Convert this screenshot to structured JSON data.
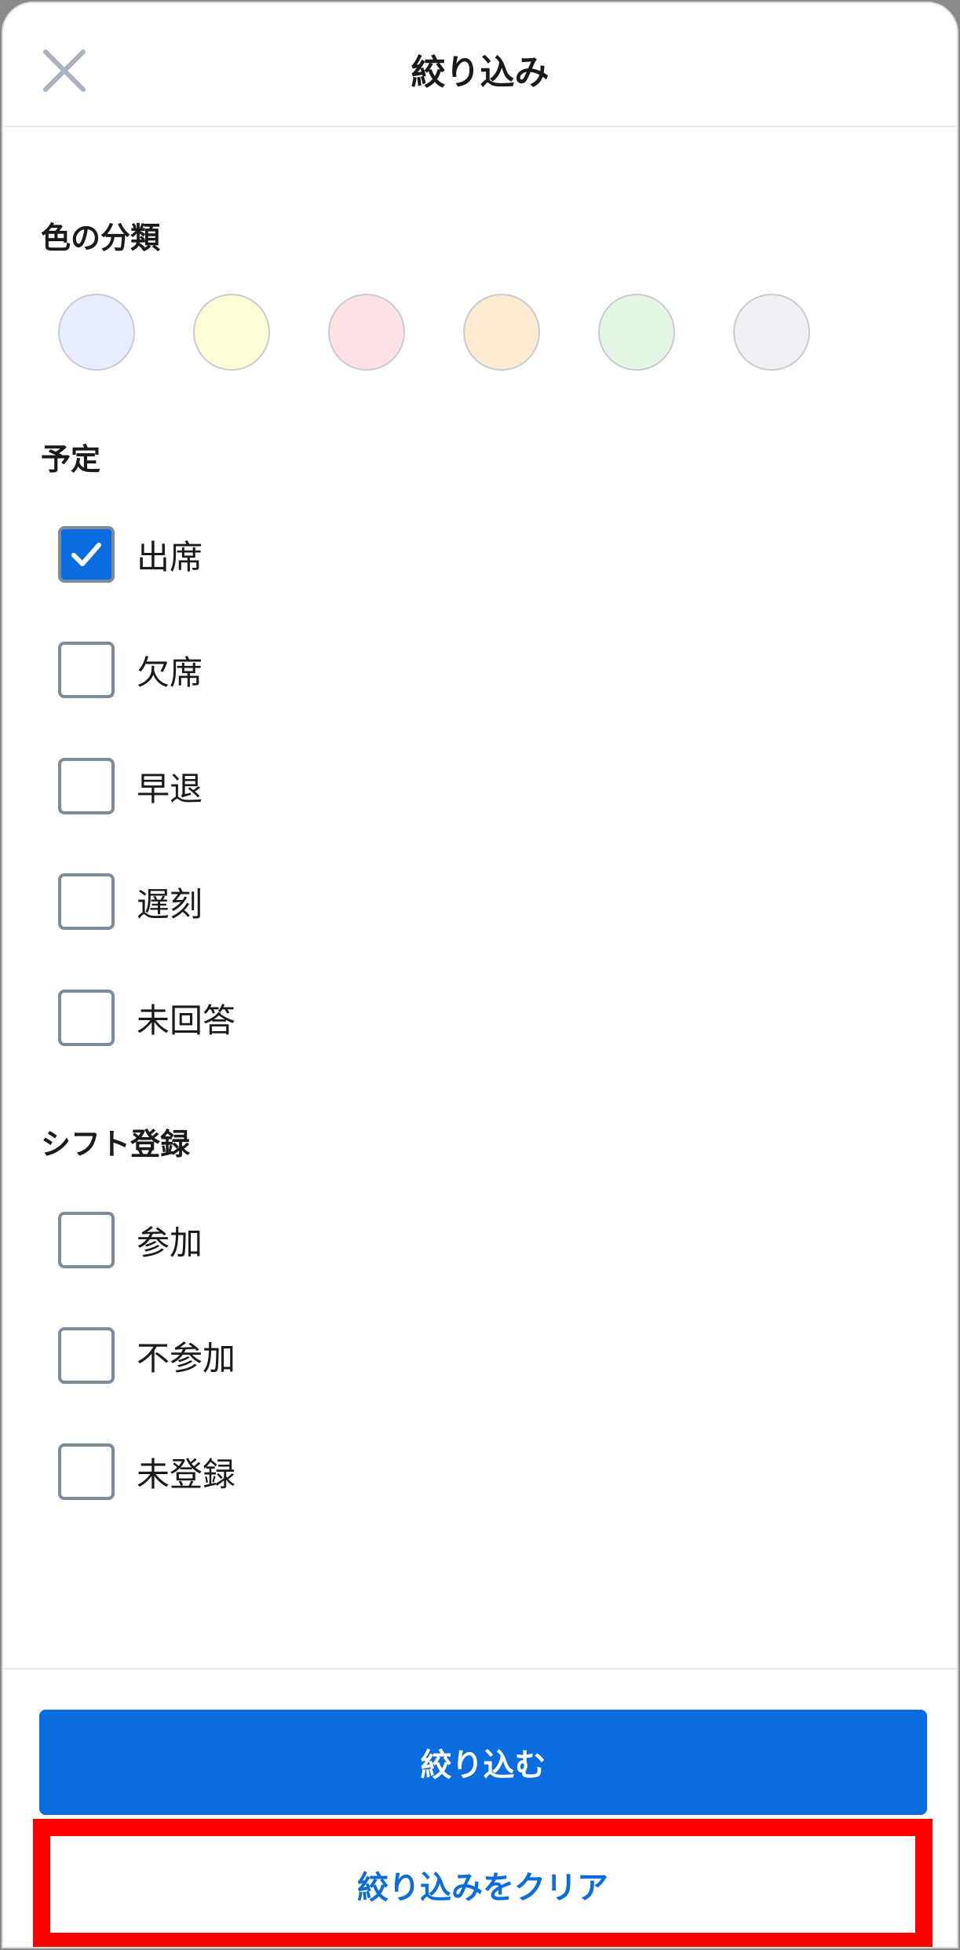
{
  "header": {
    "title": "絞り込み",
    "close_icon": "close-icon"
  },
  "colors_section": {
    "title": "色の分類",
    "swatches": [
      "#e8eeff",
      "#ffffd6",
      "#ffe2e5",
      "#ffead2",
      "#e4f7e4",
      "#f0f1f5"
    ]
  },
  "schedule_section": {
    "title": "予定",
    "items": [
      {
        "label": "出席",
        "checked": true
      },
      {
        "label": "欠席",
        "checked": false
      },
      {
        "label": "早退",
        "checked": false
      },
      {
        "label": "遅刻",
        "checked": false
      },
      {
        "label": "未回答",
        "checked": false
      }
    ]
  },
  "shift_section": {
    "title": "シフト登録",
    "items": [
      {
        "label": "参加",
        "checked": false
      },
      {
        "label": "不参加",
        "checked": false
      },
      {
        "label": "未登録",
        "checked": false
      }
    ]
  },
  "footer": {
    "apply_label": "絞り込む",
    "clear_label": "絞り込みをクリア"
  },
  "colors": {
    "accent": "#0a6cde",
    "highlight": "#ff0000"
  }
}
